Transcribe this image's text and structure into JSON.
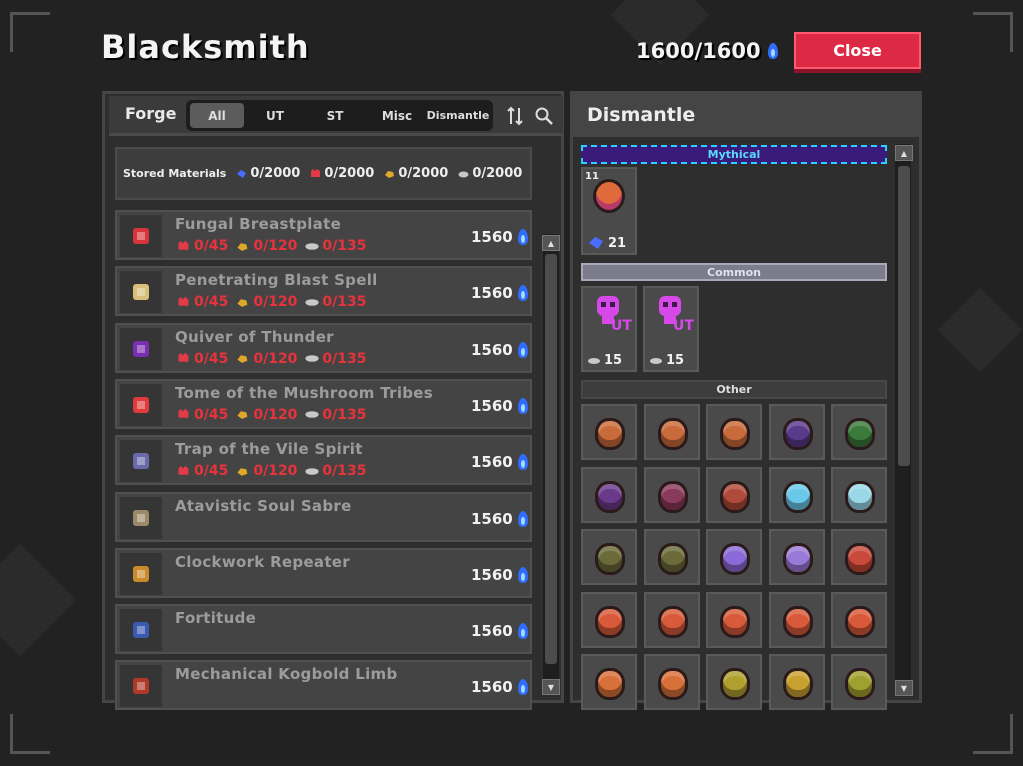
{
  "title": "Blacksmith",
  "fame": {
    "text": "1600/1600",
    "icon": "blue-fame-flame-icon"
  },
  "close_label": "Close",
  "forge": {
    "label": "Forge",
    "tabs": [
      "All",
      "UT",
      "ST",
      "Misc",
      "Dismantle"
    ],
    "active_tab": "All",
    "sort_icon": "sort-arrows-icon",
    "search_icon": "search-icon"
  },
  "stored": {
    "label": "Stored Materials",
    "materials": [
      {
        "icon": "blue-crystal-icon",
        "value": "0/2000",
        "color": "#4a6cff"
      },
      {
        "icon": "red-skull-icon",
        "value": "0/2000",
        "color": "#e23a46"
      },
      {
        "icon": "gold-nugget-icon",
        "value": "0/2000",
        "color": "#e0a82a"
      },
      {
        "icon": "silver-nugget-icon",
        "value": "0/2000",
        "color": "#c8c8c8"
      }
    ]
  },
  "items": [
    {
      "name": "Fungal Breastplate",
      "req": [
        "0/45",
        "0/120",
        "0/135"
      ],
      "cost": "1560",
      "icon": "fungal-breastplate-icon",
      "color": "#d8343c"
    },
    {
      "name": "Penetrating Blast Spell",
      "req": [
        "0/45",
        "0/120",
        "0/135"
      ],
      "cost": "1560",
      "icon": "spell-scroll-icon",
      "color": "#d8c07a"
    },
    {
      "name": "Quiver of Thunder",
      "req": [
        "0/45",
        "0/120",
        "0/135"
      ],
      "cost": "1560",
      "icon": "quiver-icon",
      "color": "#7a2fb0"
    },
    {
      "name": "Tome of the Mushroom Tribes",
      "req": [
        "0/45",
        "0/120",
        "0/135"
      ],
      "cost": "1560",
      "icon": "mushroom-tome-icon",
      "color": "#e03a3a"
    },
    {
      "name": "Trap of the Vile Spirit",
      "req": [
        "0/45",
        "0/120",
        "0/135"
      ],
      "cost": "1560",
      "icon": "trap-icon",
      "color": "#6a6aaa"
    },
    {
      "name": "Atavistic Soul Sabre",
      "req": [],
      "cost": "1560",
      "icon": "sabre-icon",
      "color": "#9a8a6a"
    },
    {
      "name": "Clockwork Repeater",
      "req": [],
      "cost": "1560",
      "icon": "crossbow-icon",
      "color": "#c88a2a"
    },
    {
      "name": "Fortitude",
      "req": [],
      "cost": "1560",
      "icon": "fortitude-staff-icon",
      "color": "#3a5ab0"
    },
    {
      "name": "Mechanical Kogbold Limb",
      "req": [],
      "cost": "1560",
      "icon": "kogbold-limb-icon",
      "color": "#b03a2a"
    }
  ],
  "dismantle": {
    "title": "Dismantle",
    "categories": {
      "mythical": "Mythical",
      "common": "Common",
      "other": "Other"
    },
    "mythical_slot": {
      "top_count": "11",
      "count": "21",
      "icon": "mythical-orb-icon"
    },
    "common_slots": [
      {
        "count": "15",
        "icon": "ut-skull-token-icon",
        "tag": "UT"
      },
      {
        "count": "15",
        "icon": "ut-skull-token-icon",
        "tag": "UT"
      }
    ],
    "other_grid": [
      [
        "#c86a3a",
        "#c86a3a",
        "#c86a3a",
        "#5a3a8a",
        "#3a7a3a"
      ],
      [
        "#6a3a8a",
        "#8a3a5a",
        "#b04a3a",
        "#6ac8e8",
        "#9ad8e8"
      ],
      [
        "#6a6a3a",
        "#6a6a3a",
        "#8a6ad8",
        "#9a7ad8",
        "#c84a3a"
      ],
      [
        "#d85a3a",
        "#d85a3a",
        "#d85a3a",
        "#d85a3a",
        "#d85a3a"
      ],
      [
        "#d8703a",
        "#d8703a",
        "#b0a030",
        "#c8a030",
        "#a0a030"
      ]
    ]
  }
}
